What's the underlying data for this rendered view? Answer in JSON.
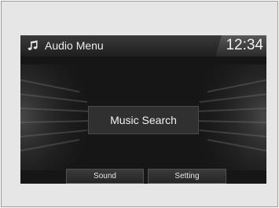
{
  "header": {
    "icon": "music-note-icon",
    "title": "Audio Menu",
    "clock": "12:34"
  },
  "main": {
    "music_search_label": "Music Search"
  },
  "footer": {
    "sound_label": "Sound",
    "setting_label": "Setting"
  },
  "colors": {
    "screen_background": "#161616",
    "title_bar": "#2e2e2e",
    "button_background": "#303030",
    "text": "#f0f0f0"
  }
}
